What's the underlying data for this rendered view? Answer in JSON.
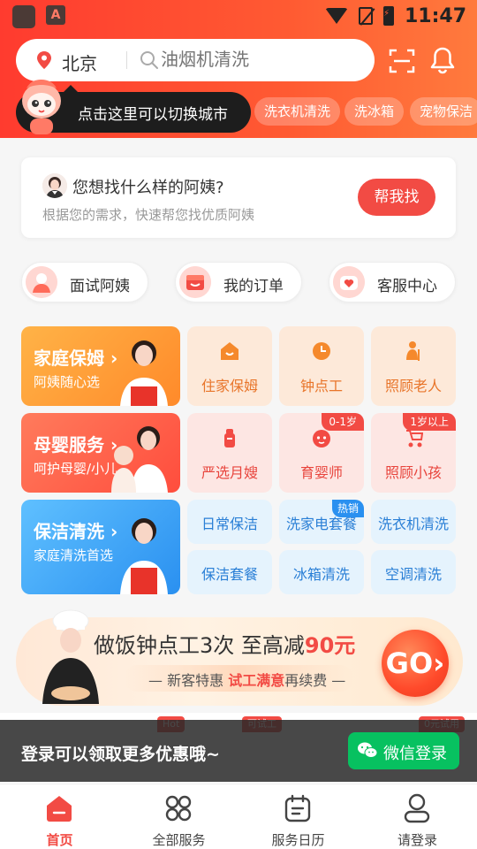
{
  "status_bar": {
    "time": "11:47",
    "app_icon_letter": "A"
  },
  "header": {
    "city": "北京",
    "search_placeholder": "油烟机清洗",
    "city_tip": "点击这里可以切换城市",
    "hot_tags": [
      "洗衣机清洗",
      "洗冰箱",
      "宠物保洁"
    ]
  },
  "finder": {
    "title": "您想找什么样的阿姨?",
    "subtitle": "根据您的需求，快速帮您找优质阿姨",
    "button": "帮我找"
  },
  "quick_links": [
    "面试阿姨",
    "我的订单",
    "客服中心"
  ],
  "categories": [
    {
      "title": "家庭保姆 ›",
      "subtitle": "阿姨随心选",
      "color": "#ff9a3c",
      "tiles": [
        {
          "label": "住家保姆",
          "icon": "house-icon",
          "badge": ""
        },
        {
          "label": "钟点工",
          "icon": "clock-icon",
          "badge": ""
        },
        {
          "label": "照顾老人",
          "icon": "elder-icon",
          "badge": ""
        }
      ]
    },
    {
      "title": "母婴服务 ›",
      "subtitle": "呵护母婴/小儿",
      "color": "#ff5f4d",
      "tiles": [
        {
          "label": "严选月嫂",
          "icon": "bottle-icon",
          "badge": ""
        },
        {
          "label": "育婴师",
          "icon": "baby-face-icon",
          "badge": "0-1岁"
        },
        {
          "label": "照顾小孩",
          "icon": "stroller-icon",
          "badge": "1岁以上"
        }
      ]
    },
    {
      "title": "保洁清洗 ›",
      "subtitle": "家庭清洗首选",
      "color": "#3aa0f5",
      "tiles": [
        {
          "label": "日常保洁",
          "badge": ""
        },
        {
          "label": "洗家电套餐",
          "badge": "热销"
        },
        {
          "label": "洗衣机清洗",
          "badge": ""
        },
        {
          "label": "保洁套餐",
          "badge": ""
        },
        {
          "label": "冰箱清洗",
          "badge": ""
        },
        {
          "label": "空调清洗",
          "badge": ""
        }
      ]
    }
  ],
  "promo": {
    "title_prefix": "做饭钟点工3次  至高减",
    "title_amount": "90元",
    "sub_prefix": "— 新客特惠 ",
    "sub_highlight": "试工满意",
    "sub_suffix": "再续费 —",
    "go": "GO›"
  },
  "strip_badges": [
    "Hot",
    "可试工",
    "0元试用"
  ],
  "login_banner": {
    "text": "登录可以领取更多优惠哦~",
    "button": "微信登录"
  },
  "tabbar": [
    {
      "label": "首页",
      "icon": "home-icon",
      "active": true
    },
    {
      "label": "全部服务",
      "icon": "grid-icon",
      "active": false
    },
    {
      "label": "服务日历",
      "icon": "calendar-icon",
      "active": false
    },
    {
      "label": "请登录",
      "icon": "user-icon",
      "active": false
    }
  ],
  "colors": {
    "brand_red": "#f24b44",
    "header_gradient_start": "#ff3b2f",
    "wechat_green": "#07c160"
  }
}
